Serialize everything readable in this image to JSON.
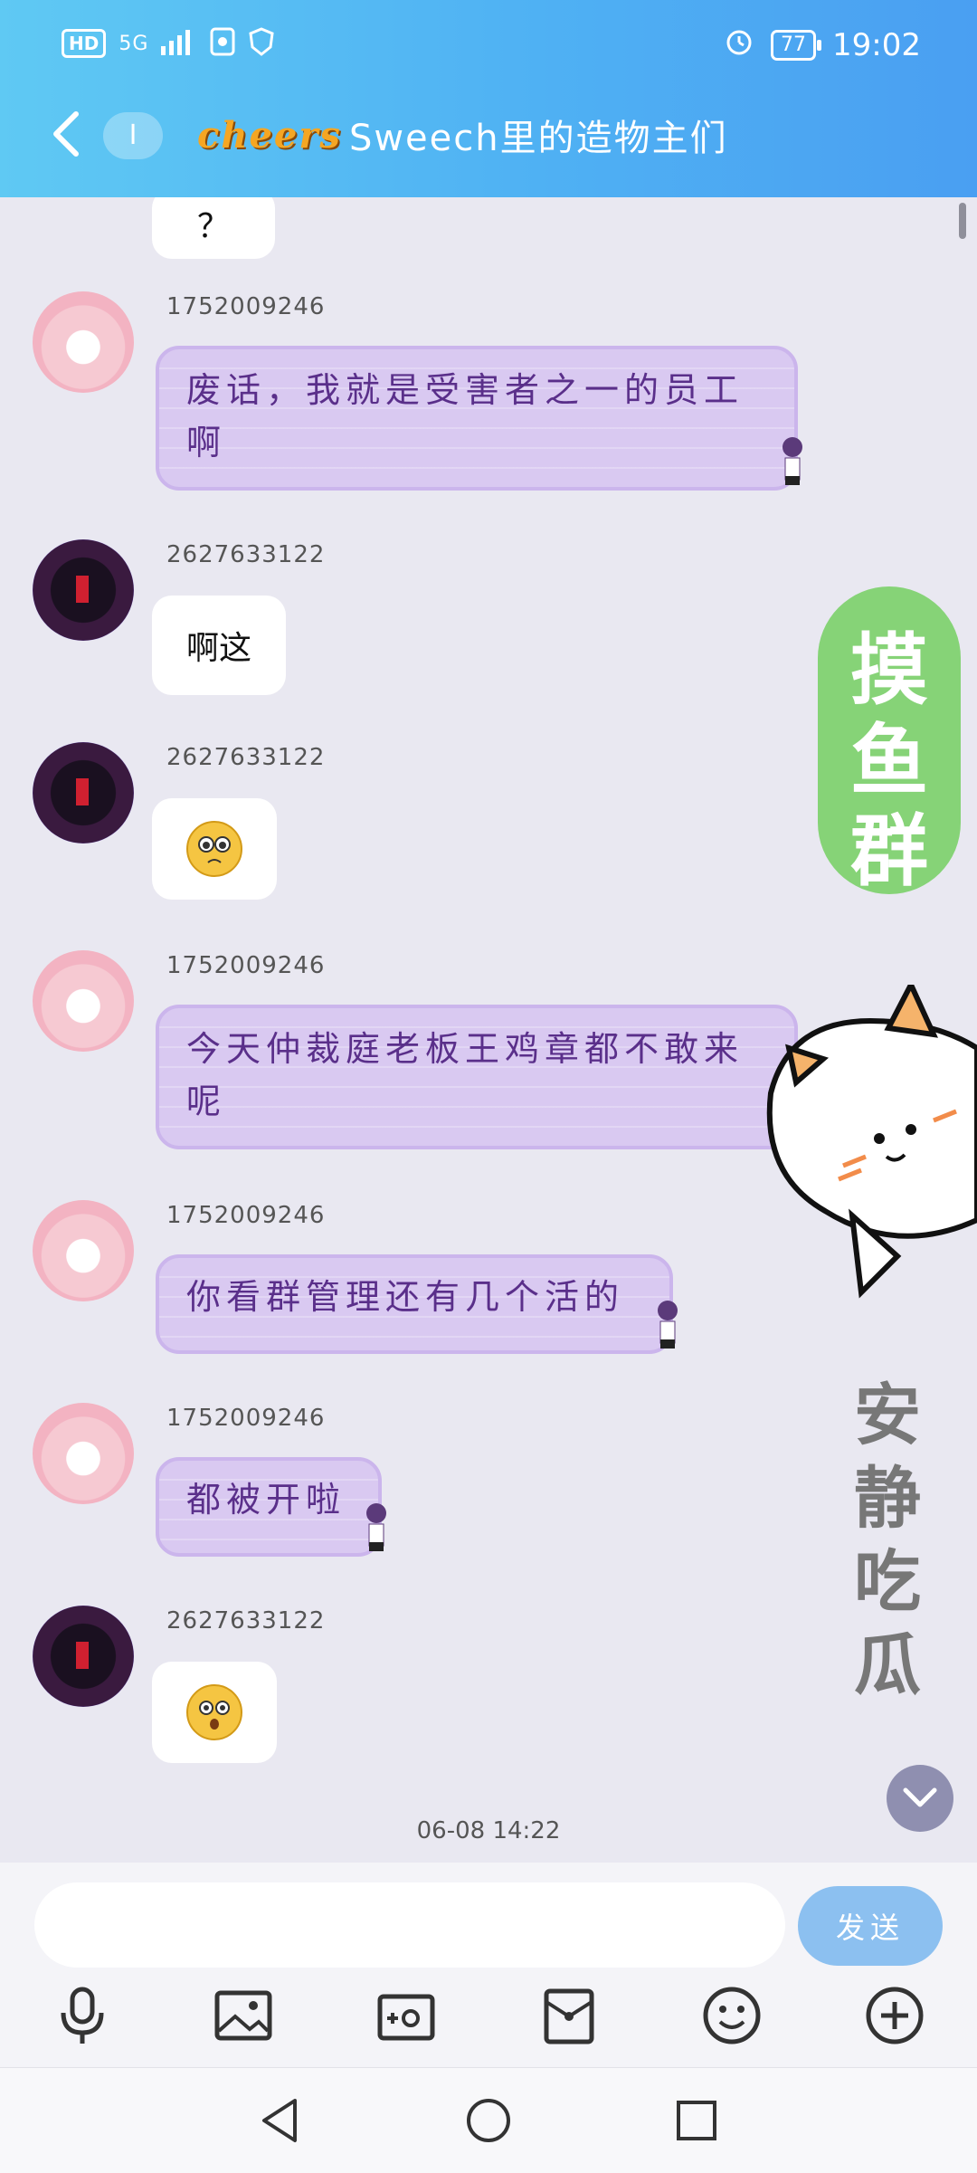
{
  "status_bar": {
    "hd_label": "HD",
    "network_label": "5G",
    "battery": "77",
    "time": "19:02"
  },
  "header": {
    "back_icon": "chevron-left-icon",
    "unread_pill": "I",
    "logo_text": "cheers",
    "title": "Sweech里的造物主们"
  },
  "messages": [
    {
      "sender": "1752009246",
      "type": "text",
      "text": "废话，我就是受害者之一的员工啊"
    },
    {
      "sender": "2627633122",
      "type": "text",
      "text": "啊这"
    },
    {
      "sender": "2627633122",
      "type": "emoji",
      "icon": "pleading-face-icon"
    },
    {
      "sender": "1752009246",
      "type": "text",
      "text": "今天仲裁庭老板王鸡章都不敢来呢"
    },
    {
      "sender": "1752009246",
      "type": "text",
      "text": "你看群管理还有几个活的"
    },
    {
      "sender": "1752009246",
      "type": "text",
      "text": "都被开啦"
    },
    {
      "sender": "2627633122",
      "type": "emoji",
      "icon": "flushed-face-icon"
    }
  ],
  "partial_top_text": "？",
  "timestamp": "06-08 14:22",
  "stickers": {
    "green_sign": [
      "摸",
      "鱼",
      "群"
    ],
    "quiet_text": [
      "安",
      "静",
      "吃",
      "瓜"
    ]
  },
  "input": {
    "placeholder": "",
    "send_label": "发送"
  },
  "toolbar_icons": [
    "microphone-icon",
    "photo-icon",
    "camera-icon",
    "red-packet-icon",
    "smile-icon",
    "plus-icon"
  ],
  "nav_icons": [
    "back-triangle-icon",
    "home-circle-icon",
    "recent-square-icon"
  ],
  "colors": {
    "header_start": "#5fc9f3",
    "header_end": "#4a9ff2",
    "chat_bg": "#e9e8f1",
    "purple_bubble": "#d9c9f1",
    "purple_text": "#5a2f8a"
  }
}
